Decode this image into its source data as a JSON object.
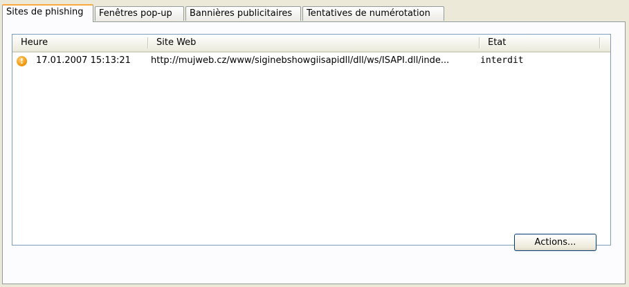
{
  "tabs": [
    {
      "label": "Sites de phishing",
      "active": true
    },
    {
      "label": "Fenêtres pop-up",
      "active": false
    },
    {
      "label": "Bannières publicitaires",
      "active": false
    },
    {
      "label": "Tentatives de numérotation",
      "active": false
    }
  ],
  "list": {
    "columns": [
      "Heure",
      "Site Web",
      "Etat"
    ],
    "rows": [
      {
        "icon": "warning-icon",
        "time": "17.01.2007 15:13:21",
        "site": "http://mujweb.cz/www/siginebshowgiisapidll/dll/ws/ISAPI.dll/inde...",
        "state": "interdit"
      }
    ]
  },
  "actions_button": "Actions...",
  "colors": {
    "active_tab_accent": "#f9a93c",
    "warning": "#f29a12"
  }
}
